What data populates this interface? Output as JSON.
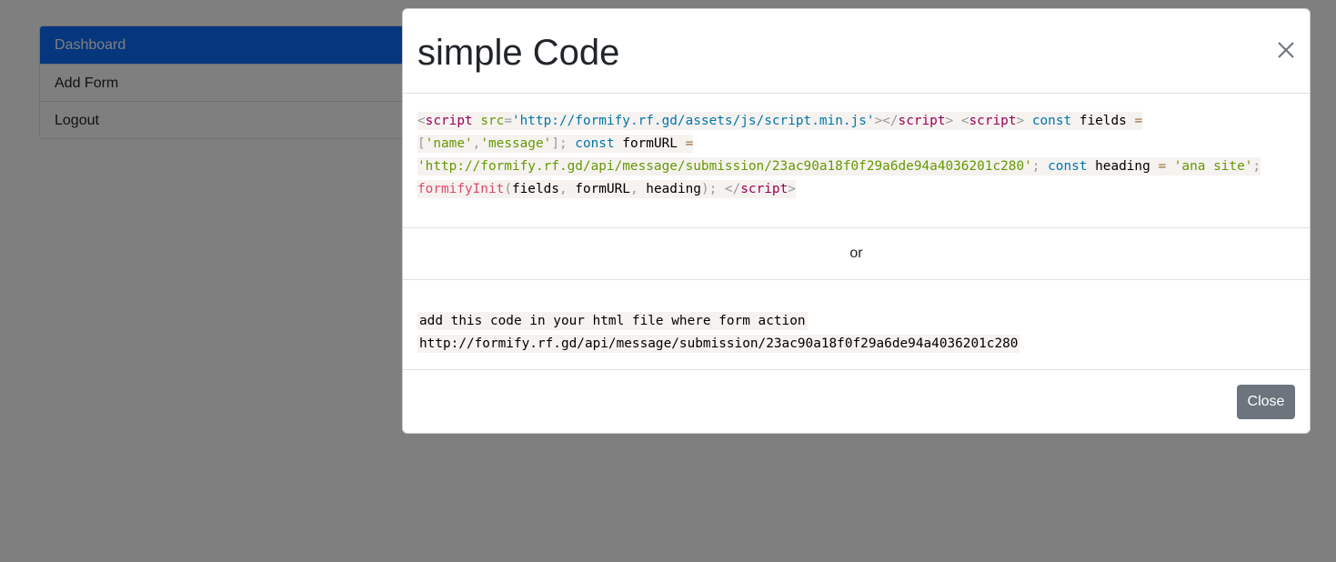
{
  "sidebar": {
    "items": [
      {
        "label": "Dashboard"
      },
      {
        "label": "Add Form"
      },
      {
        "label": "Logout"
      }
    ]
  },
  "modal": {
    "title": "simple Code",
    "code": {
      "t1": "<",
      "t2": "script",
      "t3": " src",
      "t4": "=",
      "t5": "'http://formify.rf.gd/assets/js/script.min.js'",
      "t6": "></",
      "t7": "script",
      "t8": ">",
      "t9": " <",
      "t10": "script",
      "t11": ">",
      "t12": " const",
      "t13": " fields ",
      "t14": "=",
      "t15": "[",
      "t16": "'name'",
      "t17": ",",
      "t18": "'message'",
      "t19": "];",
      "t20": " const",
      "t21": " formURL ",
      "t22": "=",
      "t23": "'http://formify.rf.gd/api/message/submission/23ac90a18f0f29a6de94a4036201c280'",
      "t24": ";",
      "t25": " const",
      "t26": " heading ",
      "t27": "=",
      "t28": " 'ana site'",
      "t29": ";",
      "t30": "formifyInit",
      "t31": "(",
      "t32": "fields",
      "t33": ",",
      "t34": " formURL",
      "t35": ",",
      "t36": " heading",
      "t37": ");",
      "t38": " </",
      "t39": "script",
      "t40": ">"
    },
    "or_text": "or",
    "desc_line1": "add this code in your html file where form action",
    "desc_line2": "http://formify.rf.gd/api/message/submission/23ac90a18f0f29a6de94a4036201c280",
    "close_label": "Close"
  },
  "colors": {
    "active_item": "#0d6efd",
    "close_button": "#6c757d",
    "backdrop": "rgba(0,0,0,0.5)"
  },
  "icons": {
    "modal_close": "close-icon"
  }
}
